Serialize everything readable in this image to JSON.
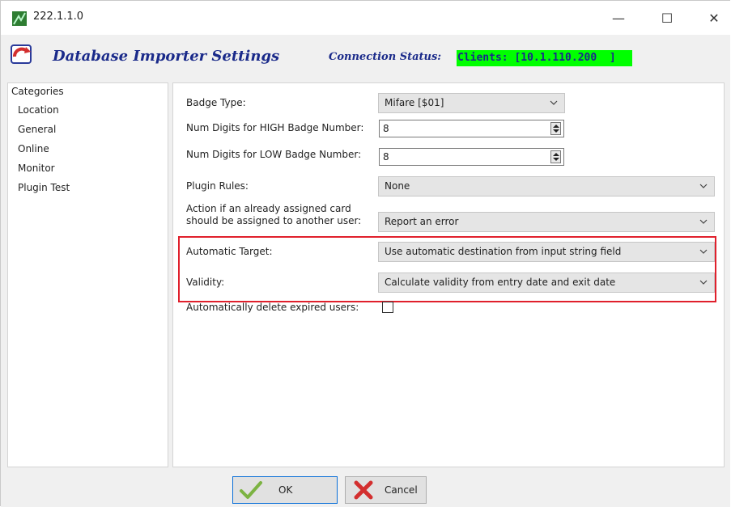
{
  "window": {
    "title": "222.1.1.0",
    "minimize": "—",
    "maximize": "☐",
    "close": "✕"
  },
  "header": {
    "title": "Database Importer Settings",
    "connection_label": "Connection Status:",
    "connection_value": "Clients: [10.1.110.200  ]",
    "connection_color": "#00ff00"
  },
  "categories": {
    "title": "Categories",
    "items": [
      "Location",
      "General",
      "Online",
      "Monitor",
      "Plugin Test"
    ]
  },
  "form": {
    "badge_type": {
      "label": "Badge Type:",
      "value": "Mifare [$01]"
    },
    "high_digits": {
      "label": "Num Digits for HIGH Badge Number:",
      "value": "8"
    },
    "low_digits": {
      "label": "Num Digits for LOW Badge Number:",
      "value": "8"
    },
    "plugin_rules": {
      "label": "Plugin Rules:",
      "value": "None"
    },
    "assigned_card": {
      "label_line1": "Action if an already assigned card",
      "label_line2": "should be assigned to another user:",
      "value": "Report an error"
    },
    "automatic_target": {
      "label": "Automatic Target:",
      "value": "Use automatic destination from input string field"
    },
    "validity": {
      "label": "Validity:",
      "value": "Calculate validity from entry date and exit date"
    },
    "delete_expired": {
      "label": "Automatically delete expired users:",
      "checked": false
    }
  },
  "highlight_color": "#e0202c",
  "buttons": {
    "ok": "OK",
    "cancel": "Cancel"
  }
}
